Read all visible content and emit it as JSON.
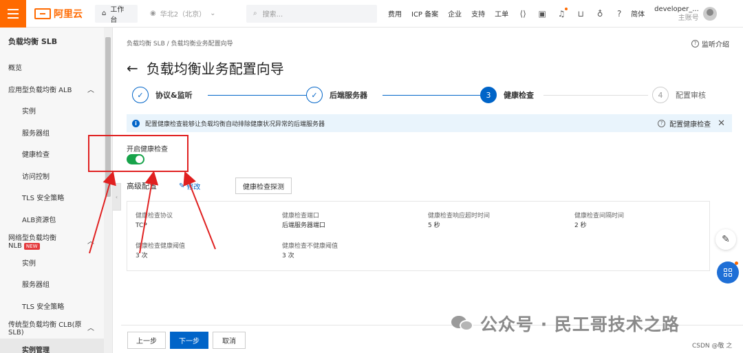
{
  "topbar": {
    "logo_text": "阿里云",
    "workspace_label": "工作台",
    "region_label": "华北2（北京）",
    "search_placeholder": "搜索...",
    "links": [
      "费用",
      "ICP 备案",
      "企业",
      "支持",
      "工单"
    ],
    "lang_label": "简体",
    "user_name": "developer_...",
    "user_role": "主账号"
  },
  "sidebar": {
    "title": "负载均衡 SLB",
    "items": [
      {
        "label": "概览",
        "level": 0
      },
      {
        "label": "应用型负载均衡 ALB",
        "level": 0,
        "expanded": true
      },
      {
        "label": "实例",
        "level": 1
      },
      {
        "label": "服务器组",
        "level": 1
      },
      {
        "label": "健康检查",
        "level": 1
      },
      {
        "label": "访问控制",
        "level": 1
      },
      {
        "label": "TLS 安全策略",
        "level": 1
      },
      {
        "label": "ALB资源包",
        "level": 1
      },
      {
        "label": "网络型负载均衡 NLB",
        "level": 0,
        "badge": "NEW",
        "expanded": true
      },
      {
        "label": "实例",
        "level": 1
      },
      {
        "label": "服务器组",
        "level": 1
      },
      {
        "label": "TLS 安全策略",
        "level": 1
      },
      {
        "label": "传统型负载均衡 CLB(原SLB)",
        "level": 0,
        "expanded": true
      },
      {
        "label": "实例管理",
        "level": 1,
        "active": true
      }
    ]
  },
  "main": {
    "breadcrumb": [
      "负载均衡 SLB",
      "负载均衡业务配置向导"
    ],
    "breadcrumb_sep": "/",
    "intro_link": "监听介绍",
    "title": "负载均衡业务配置向导",
    "steps": [
      {
        "num": "✓",
        "label": "协议&监听",
        "state": "done"
      },
      {
        "num": "✓",
        "label": "后端服务器",
        "state": "done"
      },
      {
        "num": "3",
        "label": "健康检查",
        "state": "current"
      },
      {
        "num": "4",
        "label": "配置审核",
        "state": "todo"
      }
    ],
    "notice": {
      "text": "配置健康检查能够让负载均衡自动排除健康状况异常的后端服务器",
      "link": "配置健康检查"
    },
    "health_check_toggle": {
      "label": "开启健康检查",
      "on": true
    },
    "advanced": {
      "title": "高级配置",
      "edit_label": "修改",
      "probe_button": "健康检查探测",
      "fields": [
        {
          "label": "健康检查协议",
          "value": "TCP"
        },
        {
          "label": "健康检查端口",
          "value": "后端服务器端口"
        },
        {
          "label": "健康检查响应超时时间",
          "value": "5 秒"
        },
        {
          "label": "健康检查间隔时间",
          "value": "2 秒"
        },
        {
          "label": "健康检查健康阈值",
          "value": "3 次"
        },
        {
          "label": "健康检查不健康阈值",
          "value": "3 次"
        }
      ]
    },
    "footer": {
      "prev": "上一步",
      "next": "下一步",
      "cancel": "取消"
    }
  },
  "watermark": {
    "text": "公众号 · 民工哥技术之路",
    "credit": "CSDN @敬 之"
  },
  "colors": {
    "brand": "#ff6a00",
    "primary": "#0064c8",
    "toggle_on": "#17a34a",
    "annotation": "#e02020"
  }
}
